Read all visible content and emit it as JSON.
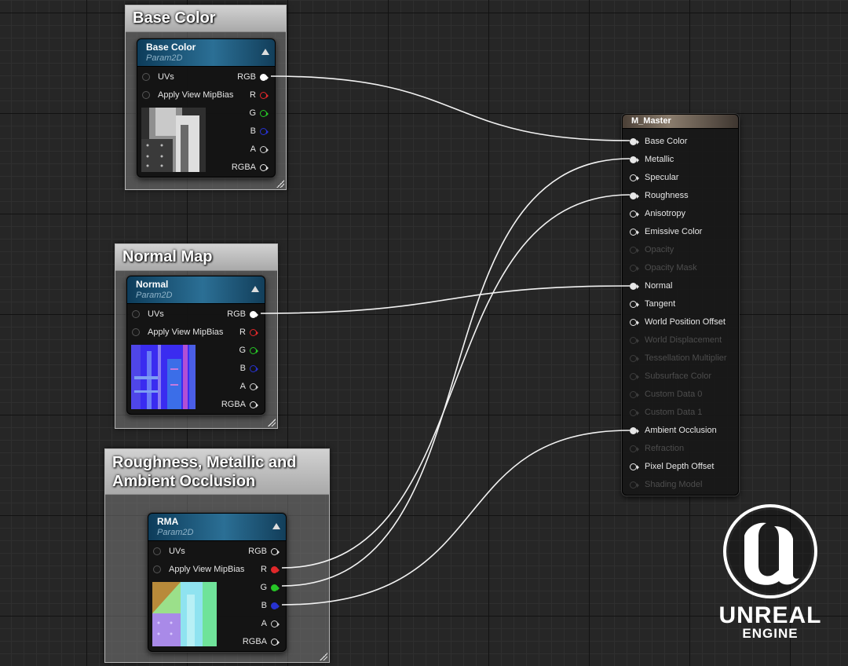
{
  "comments": {
    "base_color": "Base Color",
    "normal_map": "Normal Map",
    "rma_line1": "Roughness, Metallic and",
    "rma_line2": "Ambient Occlusion"
  },
  "nodes": {
    "base_color": {
      "name": "Base Color",
      "type": "Param2D"
    },
    "normal": {
      "name": "Normal",
      "type": "Param2D"
    },
    "rma": {
      "name": "RMA",
      "type": "Param2D"
    }
  },
  "texture_inputs": [
    "UVs",
    "Apply View MipBias"
  ],
  "texture_outputs": [
    "RGB",
    "R",
    "G",
    "B",
    "A",
    "RGBA"
  ],
  "master": {
    "title": "M_Master",
    "pins": [
      {
        "label": "Base Color",
        "enabled": true,
        "connected": true
      },
      {
        "label": "Metallic",
        "enabled": true,
        "connected": true
      },
      {
        "label": "Specular",
        "enabled": true,
        "connected": false
      },
      {
        "label": "Roughness",
        "enabled": true,
        "connected": true
      },
      {
        "label": "Anisotropy",
        "enabled": true,
        "connected": false
      },
      {
        "label": "Emissive Color",
        "enabled": true,
        "connected": false
      },
      {
        "label": "Opacity",
        "enabled": false,
        "connected": false
      },
      {
        "label": "Opacity Mask",
        "enabled": false,
        "connected": false
      },
      {
        "label": "Normal",
        "enabled": true,
        "connected": true
      },
      {
        "label": "Tangent",
        "enabled": true,
        "connected": false
      },
      {
        "label": "World Position Offset",
        "enabled": true,
        "connected": false
      },
      {
        "label": "World Displacement",
        "enabled": false,
        "connected": false
      },
      {
        "label": "Tessellation Multiplier",
        "enabled": false,
        "connected": false
      },
      {
        "label": "Subsurface Color",
        "enabled": false,
        "connected": false
      },
      {
        "label": "Custom Data 0",
        "enabled": false,
        "connected": false
      },
      {
        "label": "Custom Data 1",
        "enabled": false,
        "connected": false
      },
      {
        "label": "Ambient Occlusion",
        "enabled": true,
        "connected": true
      },
      {
        "label": "Refraction",
        "enabled": false,
        "connected": false
      },
      {
        "label": "Pixel Depth Offset",
        "enabled": true,
        "connected": false
      },
      {
        "label": "Shading Model",
        "enabled": false,
        "connected": false
      }
    ]
  },
  "connections": [
    {
      "from": "Base Color.RGB",
      "to": "Base Color"
    },
    {
      "from": "Normal.RGB",
      "to": "Normal"
    },
    {
      "from": "RMA.R",
      "to": "Roughness"
    },
    {
      "from": "RMA.G",
      "to": "Metallic"
    },
    {
      "from": "RMA.B",
      "to": "Ambient Occlusion"
    }
  ],
  "pin_colors": {
    "rgb": "#ffffff",
    "r": "#e0282a",
    "g": "#26c526",
    "b": "#2732d0",
    "a": "#cfcfcf",
    "rgba": "#e8e8e8"
  },
  "logo": {
    "word1": "UNREAL",
    "word2": "ENGINE"
  }
}
